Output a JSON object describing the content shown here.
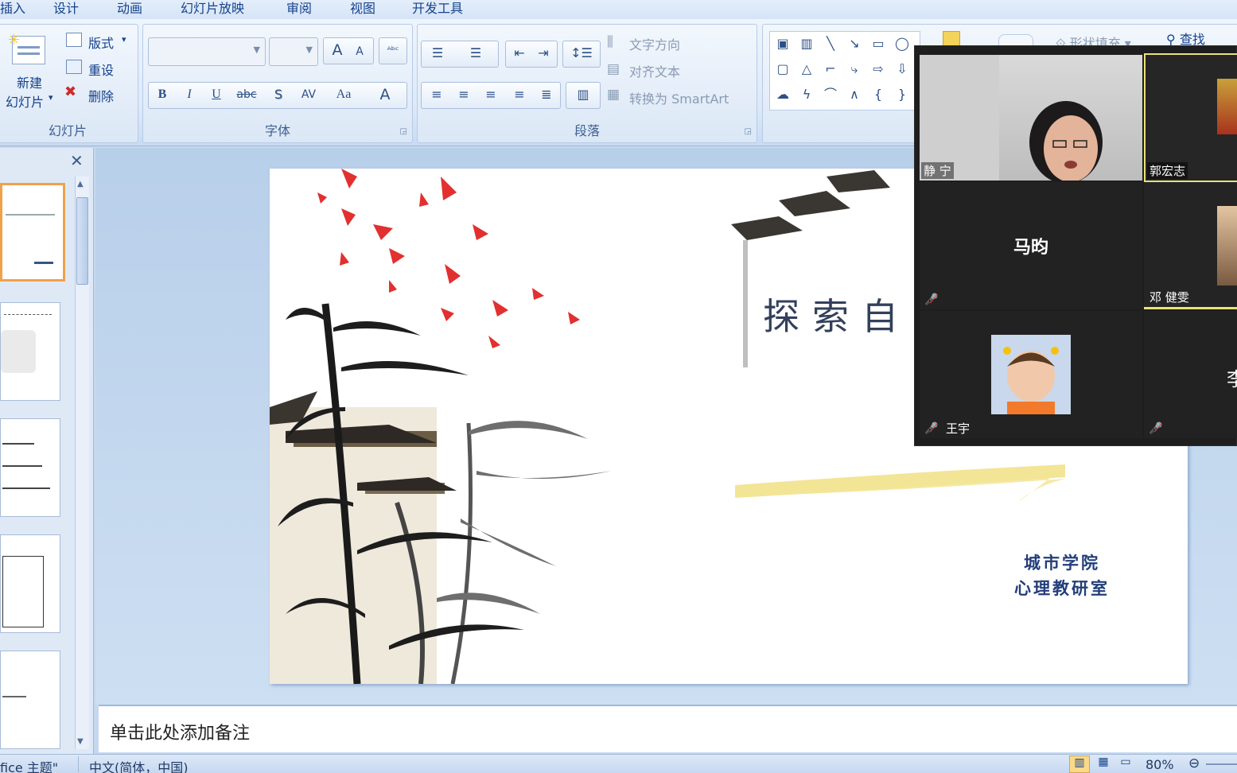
{
  "tabs": [
    "插入",
    "设计",
    "动画",
    "幻灯片放映",
    "审阅",
    "视图",
    "开发工具"
  ],
  "slides_group": {
    "label": "幻灯片",
    "new_slide_line1": "新建",
    "new_slide_line2": "幻灯片",
    "layout": "版式",
    "reset": "重设",
    "delete": "删除"
  },
  "font_group": {
    "label": "字体",
    "bold": "B",
    "italic": "I",
    "underline": "U",
    "strike": "abc",
    "shadow": "S",
    "spacing": "AV",
    "case": "Aa",
    "color": "A",
    "grow": "A",
    "shrink": "A"
  },
  "paragraph_group": {
    "label": "段落",
    "text_direction": "文字方向",
    "align_text": "对齐文本",
    "smartart": "转换为 SmartArt"
  },
  "drawing_group": {
    "shape_fill": "形状填充"
  },
  "editing_group": {
    "find": "查找"
  },
  "slide": {
    "title": "探索自",
    "org_line1": "城市学院",
    "org_line2": "心理教研室"
  },
  "notes": {
    "placeholder": "单击此处添加备注"
  },
  "status": {
    "theme": "fice 主题\"",
    "language": "中文(简体，中国)",
    "zoom": "80%"
  },
  "video": {
    "participants": [
      {
        "name": "静 宁",
        "muted": false
      },
      {
        "name": "郭宏志",
        "muted": false
      },
      {
        "name": "马昀",
        "muted": true
      },
      {
        "name": "邓 健雯",
        "muted": false
      },
      {
        "name": "王宇",
        "muted": true
      },
      {
        "name": "",
        "muted": true
      }
    ],
    "partial_name": "李"
  },
  "colors": {
    "accent": "#15428b",
    "ribbon": "#dde9f8",
    "petal": "#e23030",
    "brush": "#f5e9a8"
  }
}
